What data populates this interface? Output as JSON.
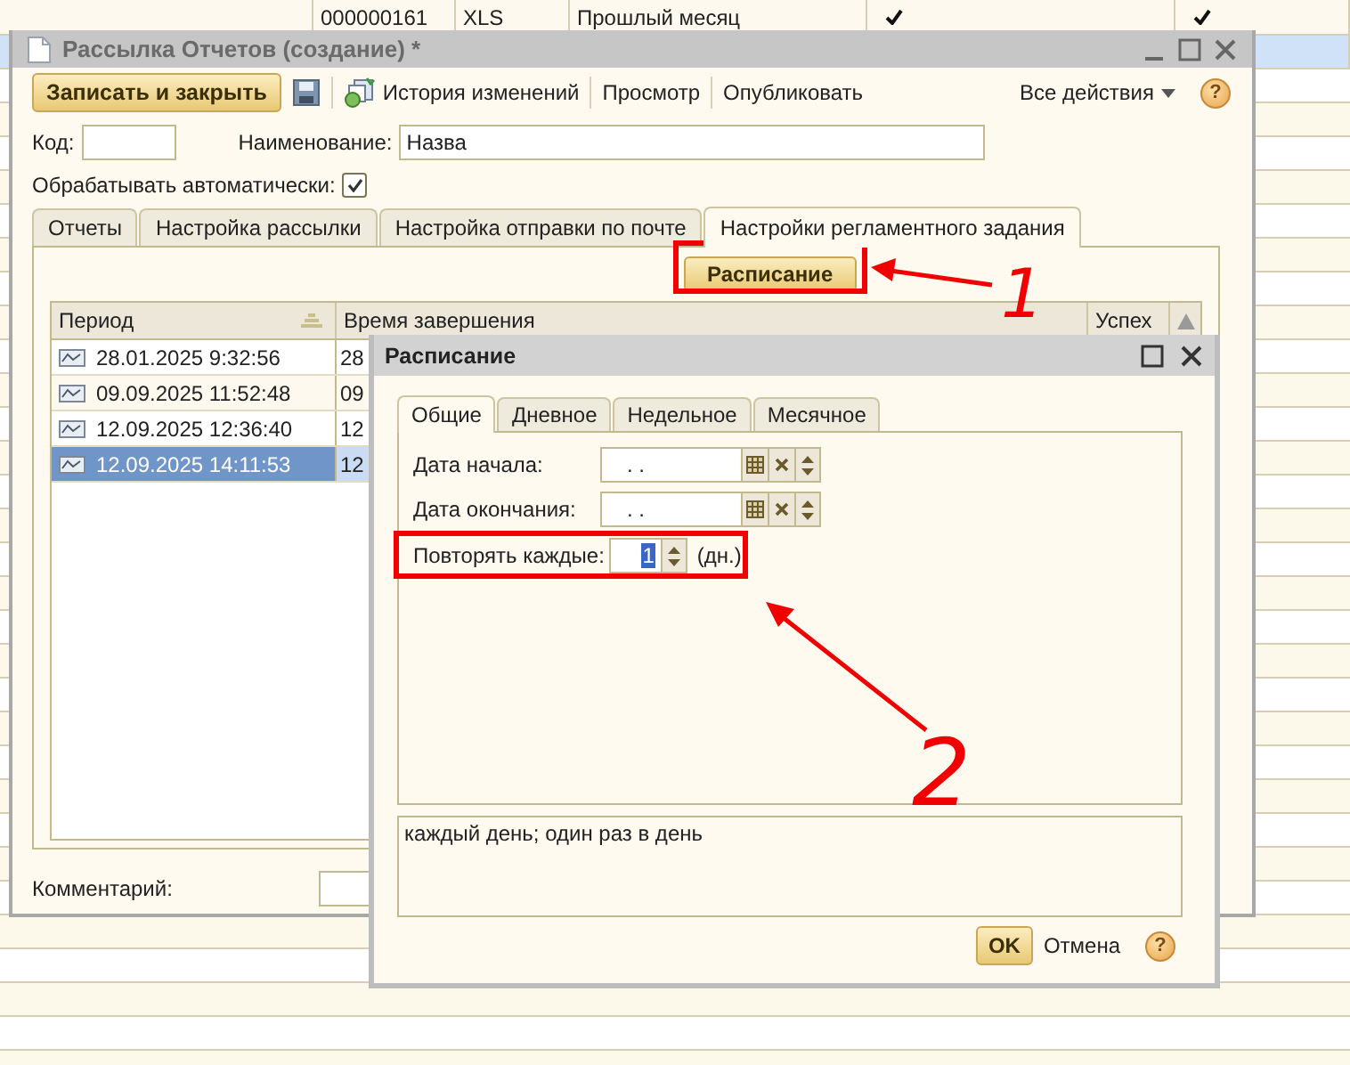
{
  "background_table": {
    "rows": [
      {
        "cells": [
          "000000161",
          "XLS",
          "Прошлый месяц"
        ],
        "checks": [
          true,
          true
        ],
        "selected": false
      },
      {
        "selected": true
      }
    ]
  },
  "main_window": {
    "title": "Рассылка Отчетов (создание) *",
    "toolbar": {
      "save_close": "Записать и закрыть",
      "history": "История изменений",
      "preview": "Просмотр",
      "publish": "Опубликовать",
      "all_actions": "Все действия",
      "help": "?"
    },
    "code": {
      "label": "Код:"
    },
    "name": {
      "label": "Наименование:",
      "value": "Назва"
    },
    "auto": {
      "label": "Обрабатывать автоматически:",
      "checked": true
    },
    "tabs": [
      {
        "label": "Отчеты",
        "selected": false
      },
      {
        "label": "Настройка рассылки",
        "selected": false
      },
      {
        "label": "Настройка отправки по почте",
        "selected": false
      },
      {
        "label": "Настройки регламентного задания",
        "selected": true
      }
    ],
    "schedule_button": "Расписание",
    "table": {
      "columns": [
        "Период",
        "Время завершения",
        "Успех"
      ],
      "rows": [
        {
          "period": "28.01.2025 9:32:56",
          "end": "28",
          "selected": false
        },
        {
          "period": "09.09.2025 11:52:48",
          "end": "09",
          "selected": false
        },
        {
          "period": "12.09.2025 12:36:40",
          "end": "12",
          "selected": false
        },
        {
          "period": "12.09.2025 14:11:53",
          "end": "12",
          "selected": true
        }
      ]
    },
    "comment": {
      "label": "Комментарий:"
    }
  },
  "dialog": {
    "title": "Расписание",
    "tabs": [
      {
        "label": "Общие",
        "selected": true
      },
      {
        "label": "Дневное",
        "selected": false
      },
      {
        "label": "Недельное",
        "selected": false
      },
      {
        "label": "Месячное",
        "selected": false
      }
    ],
    "start": {
      "label": "Дата начала:",
      "value": ". ."
    },
    "end": {
      "label": "Дата окончания:",
      "value": ". ."
    },
    "repeat": {
      "label": "Повторять каждые:",
      "value": "1",
      "unit": "(дн.)"
    },
    "description": "каждый день; один раз в день",
    "ok": "OK",
    "cancel": "Отмена",
    "help": "?"
  },
  "annotations": [
    {
      "label": "1"
    },
    {
      "label": "2"
    }
  ]
}
